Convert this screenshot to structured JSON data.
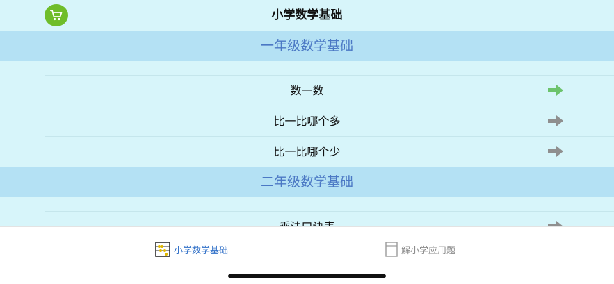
{
  "header": {
    "title": "小学数学基础",
    "cart_icon": "shopping-cart-icon",
    "cart_color": "#6fbd2a"
  },
  "sections": [
    {
      "title": "一年级数学基础",
      "items": [
        {
          "label": "数一数",
          "arrow_color": "#6cc36c"
        },
        {
          "label": "比一比哪个多",
          "arrow_color": "#8f8f8f"
        },
        {
          "label": "比一比哪个少",
          "arrow_color": "#8f8f8f"
        }
      ]
    },
    {
      "title": "二年级数学基础",
      "items": [
        {
          "label": "乘法口诀表",
          "arrow_color": "#8f8f8f"
        }
      ]
    }
  ],
  "tabbar": {
    "tabs": [
      {
        "label": "小学数学基础",
        "icon": "abacus-icon",
        "active": true
      },
      {
        "label": "解小学应用题",
        "icon": "book-icon",
        "active": false
      }
    ]
  },
  "colors": {
    "background": "#d7f5fa",
    "section_header": "#b4e1f4",
    "section_text": "#4b78c4",
    "active_tab": "#2f6fc7"
  }
}
